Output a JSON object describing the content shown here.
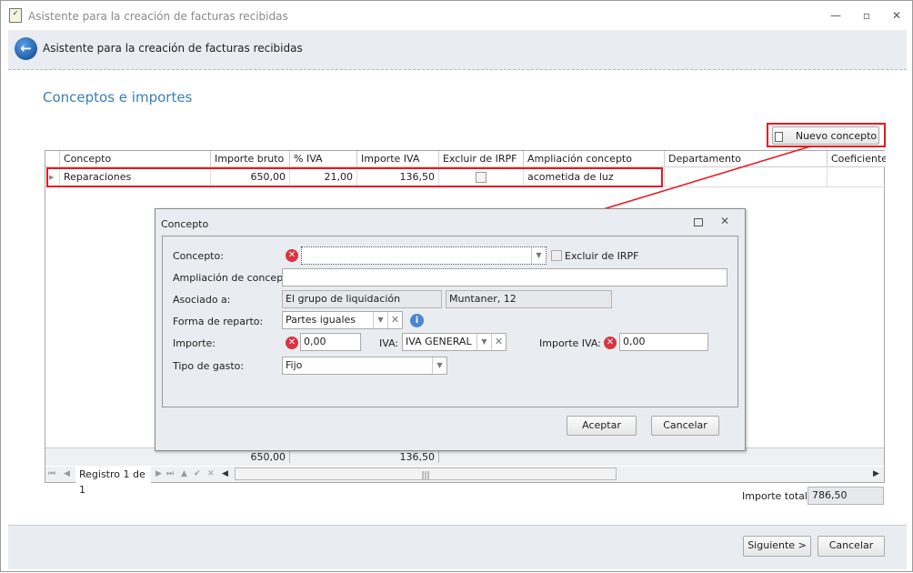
{
  "window": {
    "title": "Asistente para la creación de facturas recibidas",
    "min": "—",
    "max": "▫",
    "close": "✕"
  },
  "header": {
    "title": "Asistente para la creación de facturas recibidas"
  },
  "section_title": "Conceptos e importes",
  "new_concept_label": "Nuevo concepto",
  "grid": {
    "columns": [
      "Concepto",
      "Importe bruto",
      "% IVA",
      "Importe IVA",
      "Excluir de IRPF",
      "Ampliación concepto",
      "Departamento",
      "Coeficiente"
    ],
    "rows": [
      {
        "concepto": "Reparaciones",
        "importe_bruto": "650,00",
        "iva": "21,00",
        "importe_iva": "136,50",
        "excluir": false,
        "ampliacion": "acometida de luz",
        "departamento": "",
        "coeficiente": ""
      }
    ],
    "totals": {
      "importe_bruto": "650,00",
      "importe_iva": "136,50"
    },
    "nav": {
      "record": "Registro 1 de 1"
    }
  },
  "total": {
    "label": "Importe total:",
    "value": "786,50"
  },
  "dialog": {
    "title": "Concepto",
    "concepto_label": "Concepto:",
    "concepto_value": "",
    "excluir_label": "Excluir de IRPF",
    "ampliacion_label": "Ampliación de concepto:",
    "ampliacion_value": "",
    "asociado_label": "Asociado a:",
    "asociado_1": "El grupo de liquidación",
    "asociado_2": "Muntaner, 12",
    "reparto_label": "Forma de reparto:",
    "reparto_value": "Partes iguales",
    "importe_label": "Importe:",
    "importe_value": "0,00",
    "iva_label": "IVA:",
    "iva_value": "IVA GENERAL",
    "importe_iva_label": "Importe IVA:",
    "importe_iva_value": "0,00",
    "tipo_label": "Tipo de gasto:",
    "tipo_value": "Fijo",
    "accept": "Aceptar",
    "cancel": "Cancelar"
  },
  "footer": {
    "next": "Siguiente >",
    "cancel": "Cancelar"
  },
  "colors": {
    "accent": "#3b7fb6",
    "highlight": "#e8191f",
    "error": "#d9343f"
  }
}
